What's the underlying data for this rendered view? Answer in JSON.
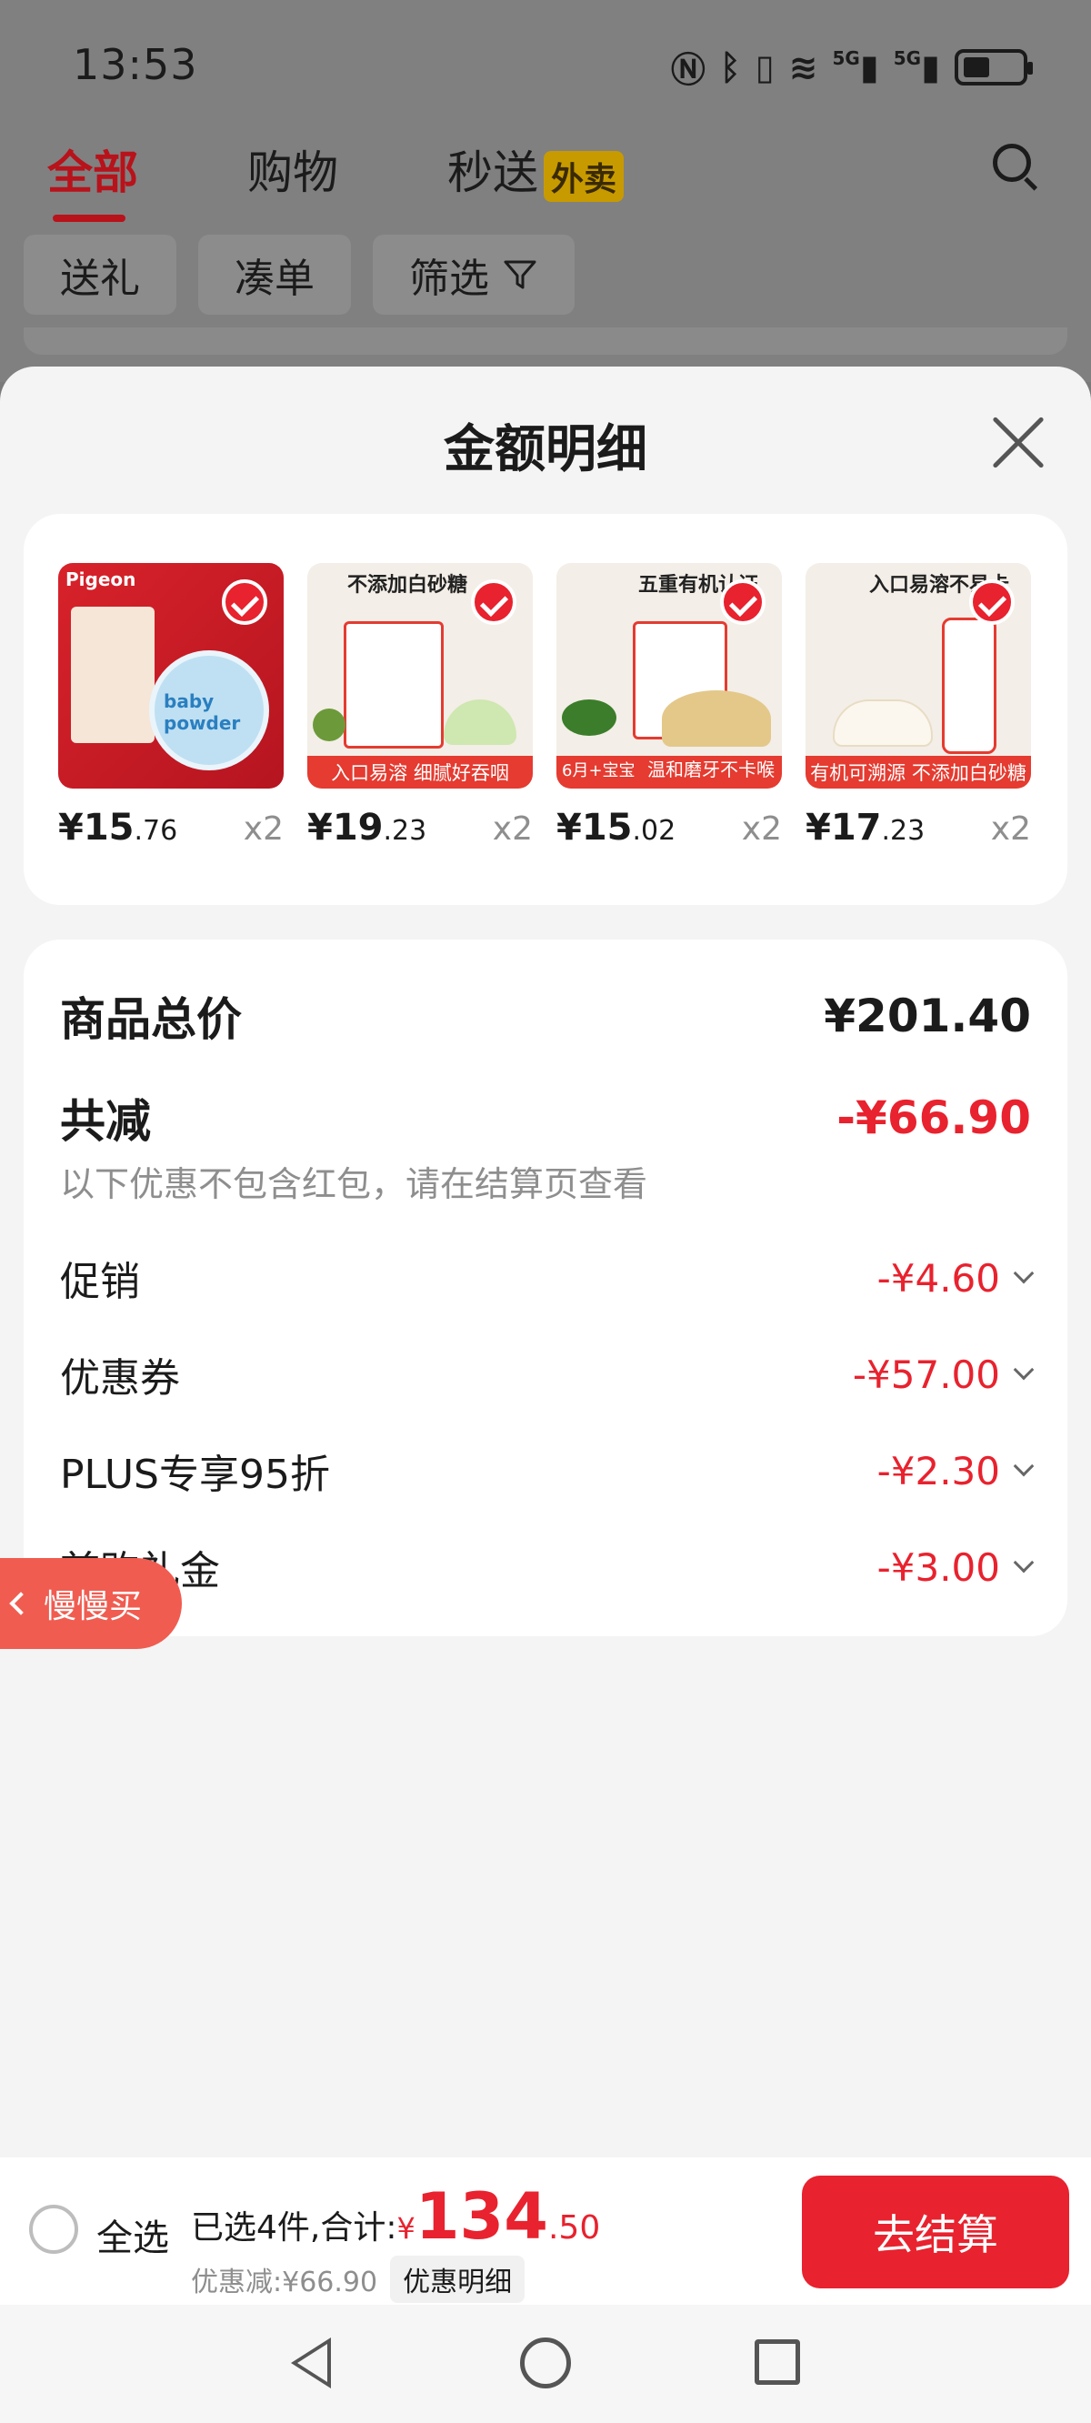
{
  "status_bar": {
    "time": "13:53",
    "icons": [
      "nfc-icon",
      "bluetooth-icon",
      "vibrate-icon",
      "wifi-icon",
      "5g-signal-icon",
      "5g-signal-icon",
      "battery-icon"
    ],
    "signal_label": "5G"
  },
  "top_tabs": [
    {
      "label": "全部",
      "active": true
    },
    {
      "label": "购物",
      "active": false
    },
    {
      "label": "秒送",
      "active": false,
      "badge": "外卖"
    }
  ],
  "filters": {
    "gift": "送礼",
    "bundle": "凑单",
    "filter": "筛选"
  },
  "sheet": {
    "title": "金额明细"
  },
  "products": [
    {
      "price_int": "¥15",
      "price_dec": ".76",
      "qty": "x2",
      "brand": "Pigeon",
      "caption": "baby powder"
    },
    {
      "price_int": "¥19",
      "price_dec": ".23",
      "qty": "x2",
      "headline": "不添加白砂糖",
      "banner": "入口易溶 细腻好吞咽"
    },
    {
      "price_int": "¥15",
      "price_dec": ".02",
      "qty": "x2",
      "headline": "五重有机认证",
      "banner": "温和磨牙不卡喉",
      "tag": "6月+宝宝"
    },
    {
      "price_int": "¥17",
      "price_dec": ".23",
      "qty": "x2",
      "headline": "入口易溶不易卡",
      "banner": "有机可溯源 不添加白砂糖"
    }
  ],
  "details": {
    "total_label": "商品总价",
    "total_value": "¥201.40",
    "reduce_label": "共减",
    "reduce_value": "-¥66.90",
    "note": "以下优惠不包含红包，请在结算页查看",
    "items": [
      {
        "label": "促销",
        "value": "-¥4.60"
      },
      {
        "label": "优惠券",
        "value": "-¥57.00"
      },
      {
        "label": "PLUS专享95折",
        "value": "-¥2.30"
      },
      {
        "label": "首购礼金",
        "value": "-¥3.00"
      }
    ]
  },
  "slow_buy": "慢慢买",
  "bottom_bar": {
    "select_all": "全选",
    "selected_text": "已选4件,合计:",
    "total_currency": "¥",
    "total_int": "134",
    "total_dec": ".50",
    "discount_text": "优惠减:¥66.90",
    "detail_button": "优惠明细",
    "checkout": "去结算"
  },
  "colors": {
    "accent": "#e8222e",
    "tab_active": "#b8121b"
  }
}
